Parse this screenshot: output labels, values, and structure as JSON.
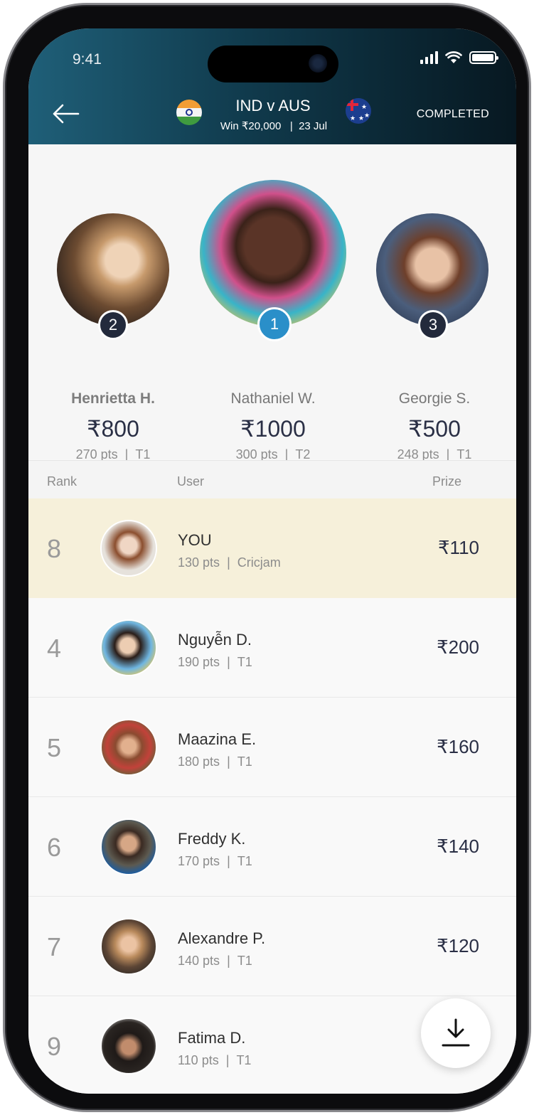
{
  "status_bar": {
    "time": "9:41"
  },
  "header": {
    "match_title": "IND v AUS",
    "win_text": "Win ₹20,000",
    "separator": "|",
    "date": "23 Jul",
    "status": "COMPLETED"
  },
  "podium": [
    {
      "rank": "2",
      "name": "Henrietta H.",
      "prize": "₹800",
      "pts": "270 pts",
      "sep": "|",
      "team": "T1"
    },
    {
      "rank": "1",
      "name": "Nathaniel W.",
      "prize": "₹1000",
      "pts": "300 pts",
      "sep": "|",
      "team": "T2"
    },
    {
      "rank": "3",
      "name": "Georgie S.",
      "prize": "₹500",
      "pts": "248 pts",
      "sep": "|",
      "team": "T1"
    }
  ],
  "table_header": {
    "rank": "Rank",
    "user": "User",
    "prize": "Prize"
  },
  "rows": [
    {
      "rank": "8",
      "name": "YOU",
      "pts": "130 pts",
      "sep": "|",
      "team": "Cricjam",
      "prize": "₹110"
    },
    {
      "rank": "4",
      "name": "Nguyễn D.",
      "pts": "190 pts",
      "sep": "|",
      "team": "T1",
      "prize": "₹200"
    },
    {
      "rank": "5",
      "name": "Maazina E.",
      "pts": "180 pts",
      "sep": "|",
      "team": "T1",
      "prize": "₹160"
    },
    {
      "rank": "6",
      "name": "Freddy K.",
      "pts": "170 pts",
      "sep": "|",
      "team": "T1",
      "prize": "₹140"
    },
    {
      "rank": "7",
      "name": "Alexandre P.",
      "pts": "140 pts",
      "sep": "|",
      "team": "T1",
      "prize": "₹120"
    },
    {
      "rank": "9",
      "name": "Fatima D.",
      "pts": "110 pts",
      "sep": "|",
      "team": "T1",
      "prize": ""
    }
  ],
  "colors": {
    "header_start": "#1f5f78",
    "header_end": "#071821",
    "rank1_badge": "#2a8fc9",
    "rank_badge": "#232a3c",
    "highlight_row": "#f6f0da",
    "prize_text": "#2a2f45"
  },
  "icons": {
    "back": "arrow-left-icon",
    "download": "download-icon"
  }
}
